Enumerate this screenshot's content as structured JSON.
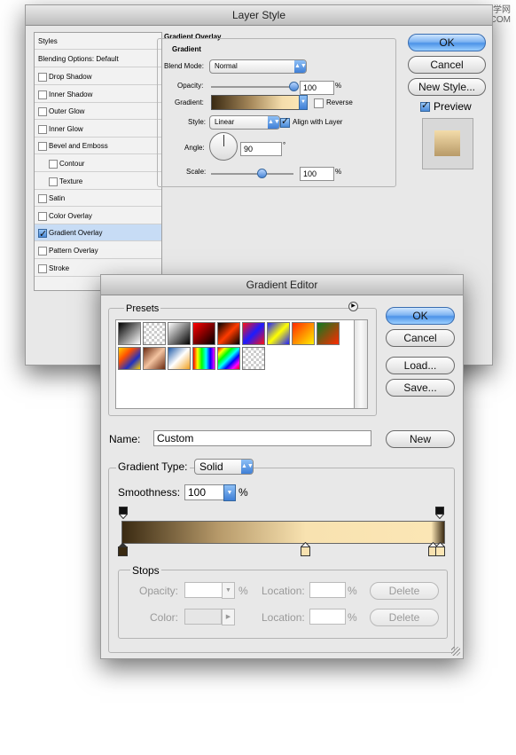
{
  "watermark": "网页教学网\nWWW.WEBJX.COM",
  "layer_style": {
    "title": "Layer Style",
    "sidebar": {
      "header": "Styles",
      "blending": "Blending Options: Default",
      "items": [
        {
          "label": "Drop Shadow",
          "checked": false
        },
        {
          "label": "Inner Shadow",
          "checked": false
        },
        {
          "label": "Outer Glow",
          "checked": false
        },
        {
          "label": "Inner Glow",
          "checked": false
        },
        {
          "label": "Bevel and Emboss",
          "checked": false
        },
        {
          "label": "Contour",
          "checked": false,
          "indent": true
        },
        {
          "label": "Texture",
          "checked": false,
          "indent": true
        },
        {
          "label": "Satin",
          "checked": false
        },
        {
          "label": "Color Overlay",
          "checked": false
        },
        {
          "label": "Gradient Overlay",
          "checked": true,
          "selected": true
        },
        {
          "label": "Pattern Overlay",
          "checked": false
        },
        {
          "label": "Stroke",
          "checked": false
        }
      ]
    },
    "panel": {
      "section_title": "Gradient Overlay",
      "group_title": "Gradient",
      "blend_mode_label": "Blend Mode:",
      "blend_mode_value": "Normal",
      "opacity_label": "Opacity:",
      "opacity_value": "100",
      "opacity_unit": "%",
      "gradient_label": "Gradient:",
      "reverse_label": "Reverse",
      "style_label": "Style:",
      "style_value": "Linear",
      "align_label": "Align with Layer",
      "angle_label": "Angle:",
      "angle_value": "90",
      "angle_unit": "°",
      "scale_label": "Scale:",
      "scale_value": "100",
      "scale_unit": "%"
    },
    "buttons": {
      "ok": "OK",
      "cancel": "Cancel",
      "new_style": "New Style...",
      "preview": "Preview"
    }
  },
  "gradient_editor": {
    "title": "Gradient Editor",
    "presets_label": "Presets",
    "buttons": {
      "ok": "OK",
      "cancel": "Cancel",
      "load": "Load...",
      "save": "Save...",
      "new": "New"
    },
    "name_label": "Name:",
    "name_value": "Custom",
    "type_label": "Gradient Type:",
    "type_value": "Solid",
    "smoothness_label": "Smoothness:",
    "smoothness_value": "100",
    "smoothness_unit": "%",
    "stops": {
      "title": "Stops",
      "opacity_label": "Opacity:",
      "opacity_unit": "%",
      "location_label": "Location:",
      "location_unit": "%",
      "color_label": "Color:",
      "delete_label": "Delete"
    },
    "gradient_colors": [
      "#3a2a12",
      "#b79a6a",
      "#f8e2b0",
      "#fbe6b5"
    ]
  }
}
